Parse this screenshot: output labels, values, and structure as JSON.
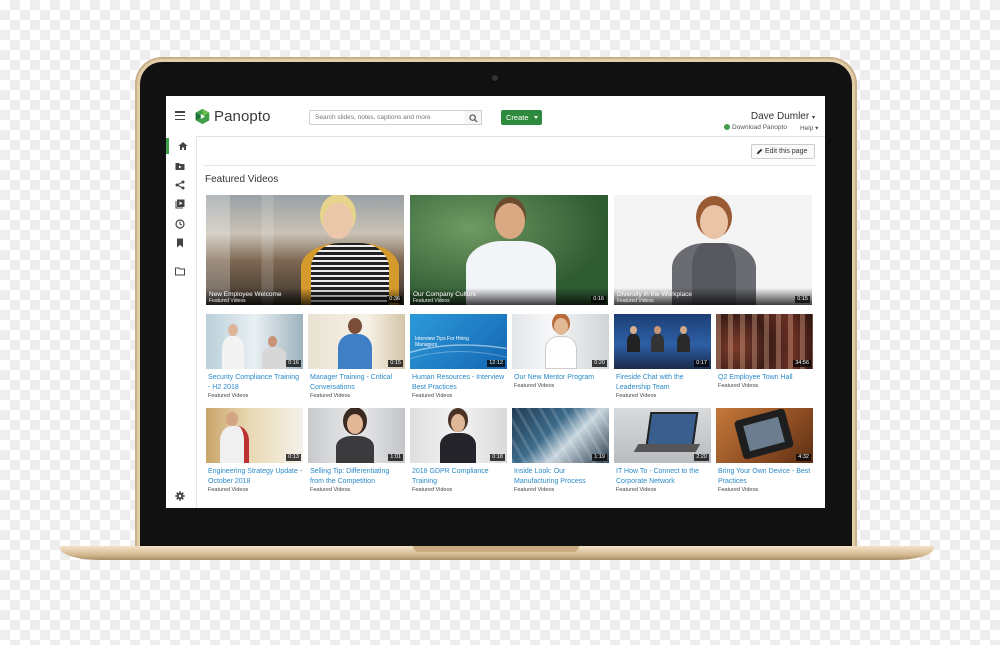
{
  "header": {
    "logo": "Panopto",
    "search_placeholder": "Search slides, notes, captions and more",
    "create_label": "Create",
    "user_name": "Dave Dumler",
    "download_label": "Download Panopto",
    "help_label": "Help"
  },
  "sidebar": {
    "items": [
      "home-icon",
      "folder-video-icon",
      "share-icon",
      "playlist-icon",
      "clock-icon",
      "bookmark-icon",
      "folder-icon"
    ],
    "settings": "gear-icon"
  },
  "main": {
    "edit_label": "Edit this page",
    "section_title": "Featured Videos",
    "featured": [
      {
        "title": "New Employee Welcome",
        "category": "Featured Videos",
        "duration": "0:36"
      },
      {
        "title": "Our Company Culture",
        "category": "Featured Videos",
        "duration": "0:16"
      },
      {
        "title": "Diversity in the Workplace",
        "category": "Featured Videos",
        "duration": "0:15"
      }
    ],
    "row1": [
      {
        "title": "Security Compliance Training - H2 2018",
        "category": "Featured Videos",
        "duration": "0:16"
      },
      {
        "title": "Manager Training - Critical Conversations",
        "category": "Featured Videos",
        "duration": "0:15"
      },
      {
        "title": "Human Resources - Interview Best Practices",
        "category": "Featured Videos",
        "duration": "12:12",
        "thumb_text": "Interview Tips For Hiring Managers"
      },
      {
        "title": "Our New Mentor Program",
        "category": "Featured Videos",
        "duration": "0:20"
      },
      {
        "title": "Fireside Chat with the Leadership Team",
        "category": "Featured Videos",
        "duration": "0:17"
      },
      {
        "title": "Q2 Employee Town Hall",
        "category": "Featured Videos",
        "duration": "34:56"
      }
    ],
    "row2": [
      {
        "title": "Engineering Strategy Update - October 2018",
        "category": "Featured Videos",
        "duration": "0:13"
      },
      {
        "title": "Selling Tip: Differentiating from the Competition",
        "category": "Featured Videos",
        "duration": "1:01"
      },
      {
        "title": "2018 GDPR Compliance Training",
        "category": "Featured Videos",
        "duration": "0:18"
      },
      {
        "title": "Inside Look: Our Manufacturing Process",
        "category": "Featured Videos",
        "duration": "1:19"
      },
      {
        "title": "IT How To - Connect to the Corporate Network",
        "category": "Featured Videos",
        "duration": "2:20"
      },
      {
        "title": "Bring Your Own Device - Best Practices",
        "category": "Featured Videos",
        "duration": "4:32"
      }
    ]
  },
  "colors": {
    "accent": "#2e8b3e",
    "link": "#2a8ac8",
    "laptop_frame": "#e2cda9"
  }
}
